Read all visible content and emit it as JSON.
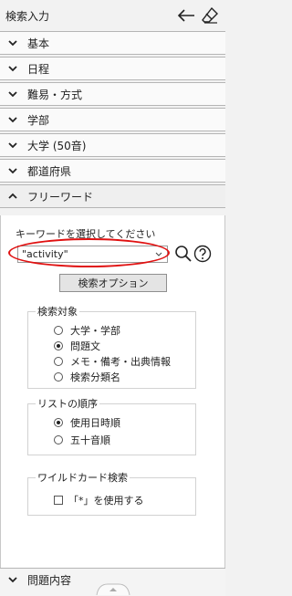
{
  "header": {
    "title": "検索入力"
  },
  "sections": [
    {
      "label": "基本"
    },
    {
      "label": "日程"
    },
    {
      "label": "難易・方式"
    },
    {
      "label": "学部"
    },
    {
      "label": "大学 (50音)"
    },
    {
      "label": "都道府県"
    },
    {
      "label": "フリーワード"
    }
  ],
  "freeword": {
    "prompt": "キーワードを選択してください",
    "value": "\"activity\"",
    "options_button": "検索オプション",
    "target": {
      "title": "検索対象",
      "options": [
        "大学・学部",
        "問題文",
        "メモ・備考・出典情報",
        "検索分類名"
      ],
      "selected": 1
    },
    "order": {
      "title": "リストの順序",
      "options": [
        "使用日時順",
        "五十音順"
      ],
      "selected": 0
    },
    "wildcard": {
      "title": "ワイルドカード検索",
      "checkbox_label": "「*」を使用する",
      "checked": false
    }
  },
  "footer": {
    "label": "問題内容"
  },
  "colors": {
    "highlight_oval": "#e01010"
  }
}
